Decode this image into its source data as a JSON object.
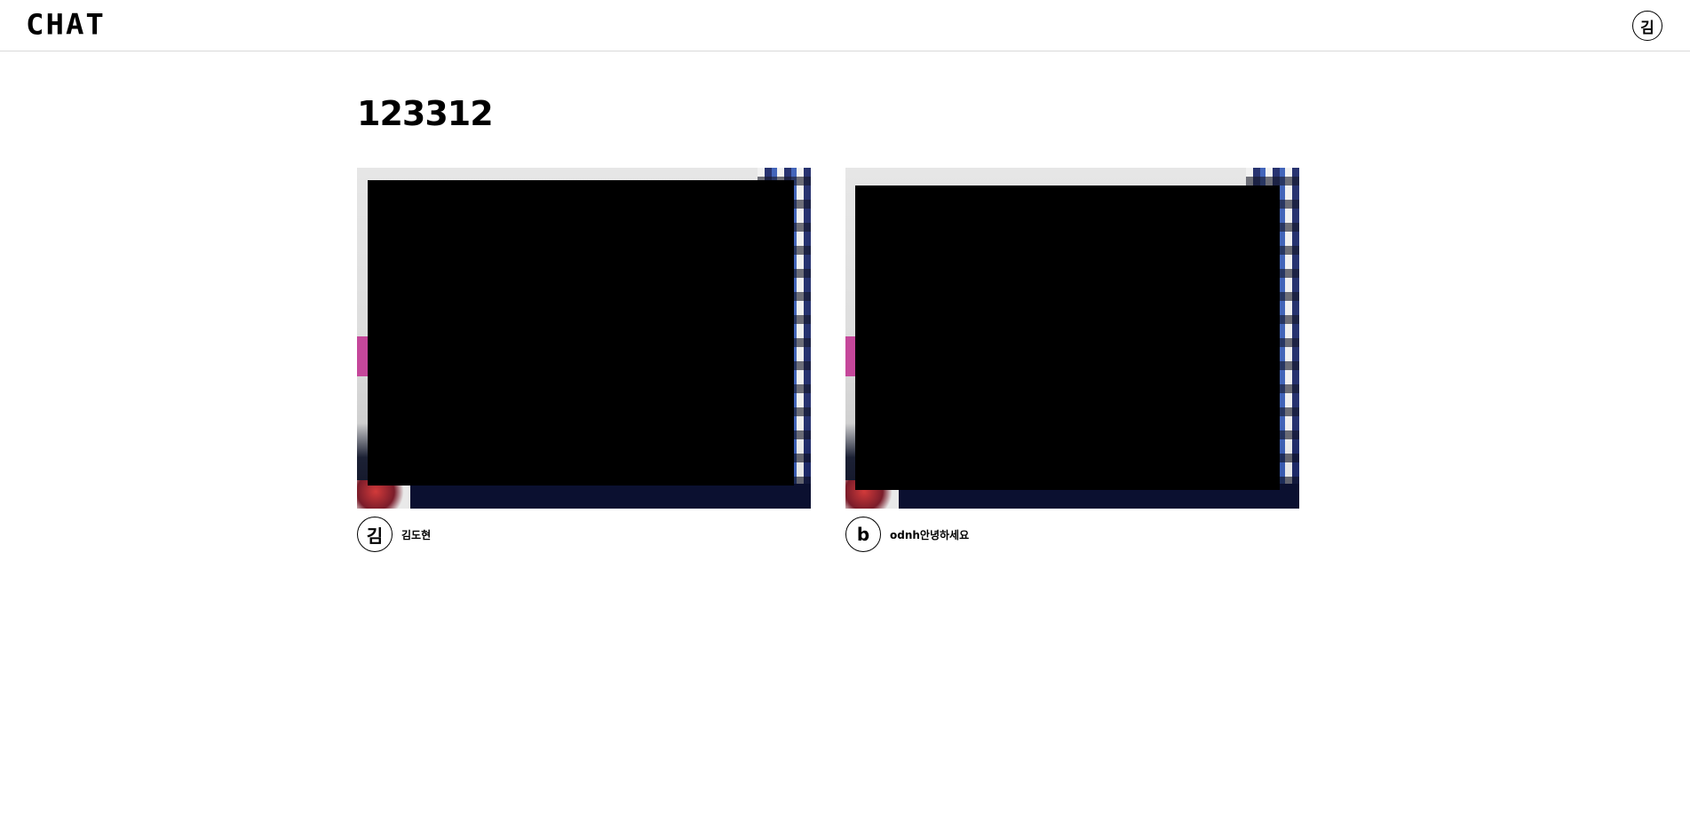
{
  "header": {
    "logo": "CHAT",
    "avatar_initial": "김"
  },
  "room": {
    "title": "123312"
  },
  "participants": [
    {
      "avatar_initial": "김",
      "name": "김도현"
    },
    {
      "avatar_initial": "b",
      "name": "odnh안녕하세요"
    }
  ]
}
